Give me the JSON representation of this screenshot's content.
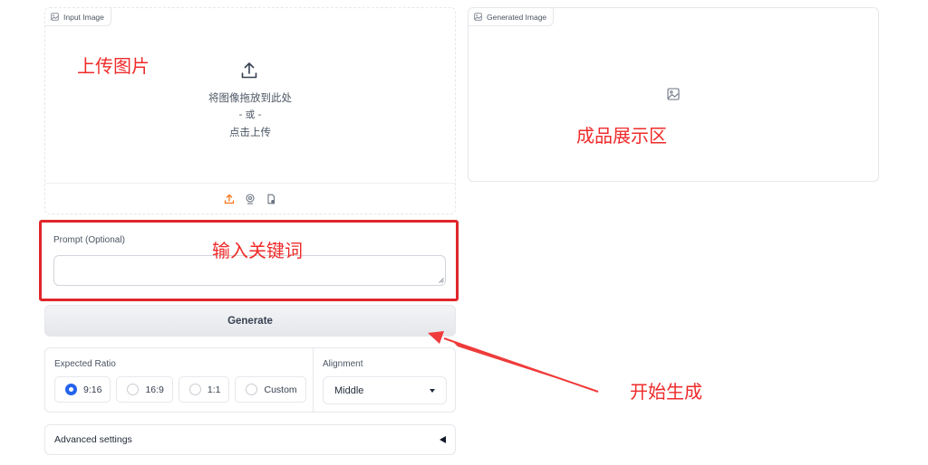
{
  "input_panel": {
    "tag_label": "Input Image",
    "drop_text": "将图像拖放到此处",
    "or_text": "- 或 -",
    "click_text": "点击上传"
  },
  "output_panel": {
    "tag_label": "Generated Image"
  },
  "prompt": {
    "label": "Prompt (Optional)",
    "value": "",
    "placeholder": ""
  },
  "generate": {
    "label": "Generate"
  },
  "options": {
    "ratio_label": "Expected Ratio",
    "ratios": [
      "9:16",
      "16:9",
      "1:1",
      "Custom"
    ],
    "selected_ratio": "9:16",
    "alignment_label": "Alignment",
    "alignment_value": "Middle"
  },
  "advanced": {
    "label": "Advanced settings"
  },
  "annotations": {
    "upload": "上传图片",
    "result": "成品展示区",
    "keywords": "输入关键词",
    "start": "开始生成"
  },
  "colors": {
    "annotation_red": "#e0262a",
    "accent_orange": "#f97316",
    "radio_blue": "#2563eb"
  }
}
